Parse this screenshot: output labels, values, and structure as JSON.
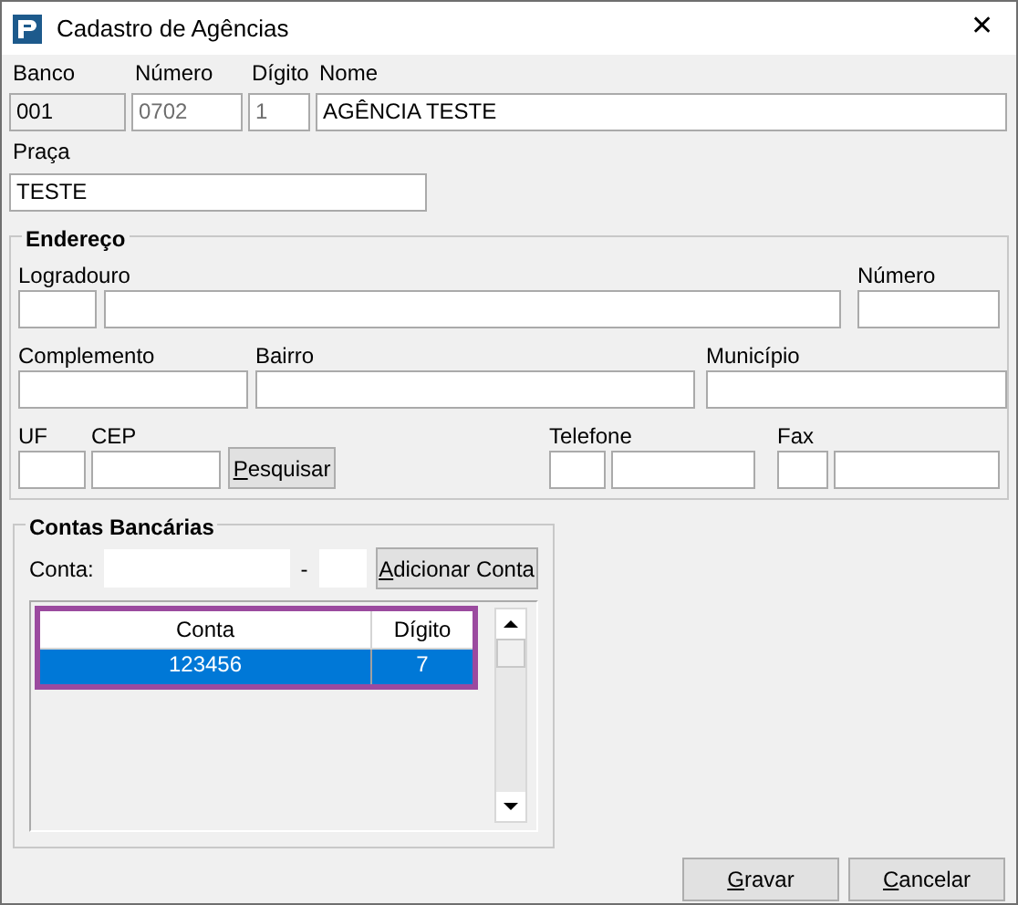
{
  "window": {
    "title": "Cadastro de Agências",
    "close": "✕"
  },
  "header_fields": [
    {
      "label": "Banco",
      "value": "001",
      "readonly": true,
      "disabled": false
    },
    {
      "label": "Número",
      "value": "0702",
      "readonly": false,
      "disabled": true
    },
    {
      "label": "Dígito",
      "value": "1",
      "readonly": false,
      "disabled": true
    },
    {
      "label": "Nome",
      "value": "AGÊNCIA TESTE",
      "readonly": false,
      "disabled": false
    }
  ],
  "praca": {
    "label": "Praça",
    "value": "TESTE"
  },
  "endereco": {
    "title": "Endereço",
    "logradouro": "Logradouro",
    "numero": "Número",
    "complemento": "Complemento",
    "bairro": "Bairro",
    "municipio": "Município",
    "uf": "UF",
    "cep": "CEP",
    "pesquisar": "Pesquisar",
    "telefone": "Telefone",
    "fax": "Fax"
  },
  "contas": {
    "title": "Contas Bancárias",
    "conta_label": "Conta:",
    "separator": "-",
    "add_button": "Adicionar Conta",
    "table": {
      "columns": [
        "Conta",
        "Dígito"
      ],
      "rows": [
        {
          "cells": [
            "123456",
            "7"
          ],
          "selected": true
        }
      ]
    },
    "highlighted": true
  },
  "buttons": [
    "Gravar",
    "Cancelar"
  ]
}
